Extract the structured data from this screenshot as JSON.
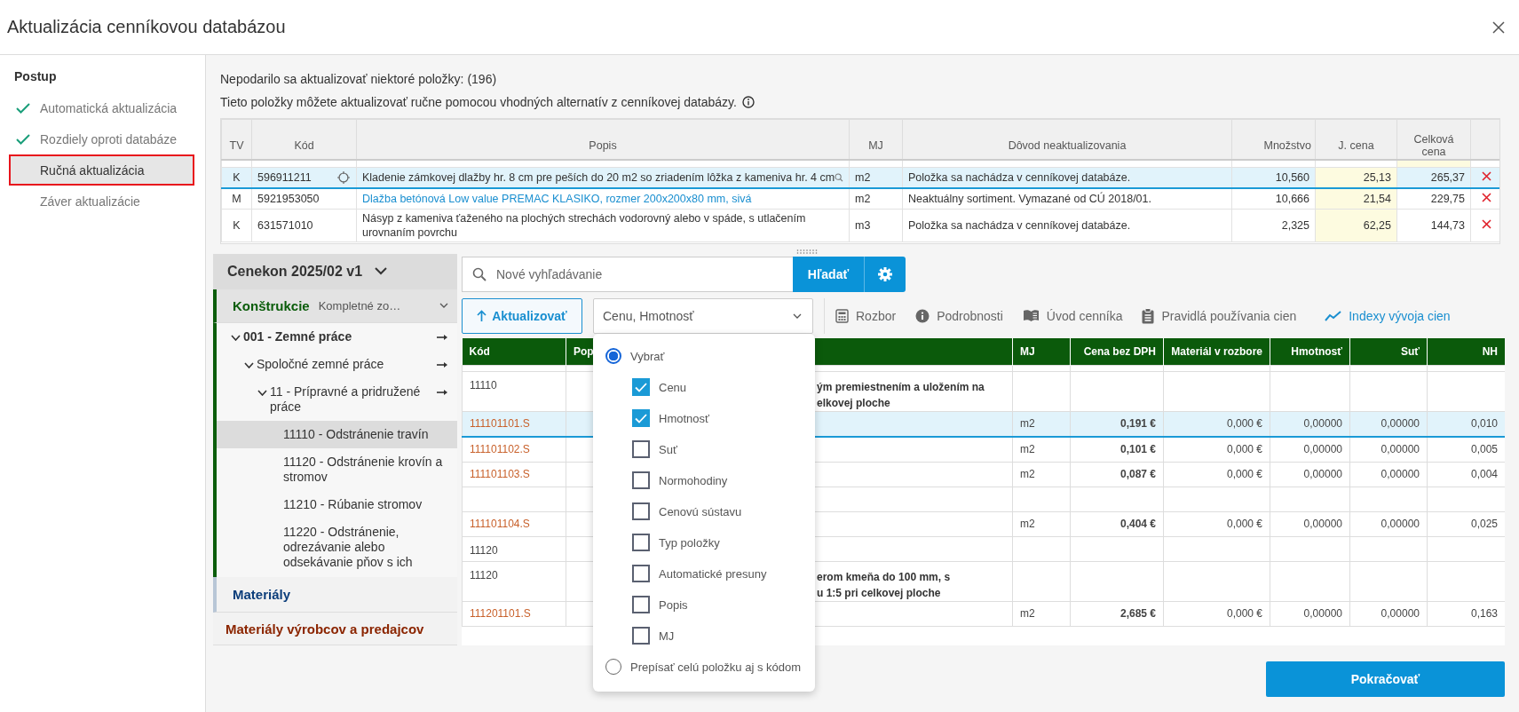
{
  "window": {
    "title": "Aktualizácia cenníkovou databázou"
  },
  "steps_title": "Postup",
  "steps": [
    {
      "label": "Automatická aktualizácia",
      "done": true,
      "selected": false
    },
    {
      "label": "Rozdiely oproti databáze",
      "done": true,
      "selected": false
    },
    {
      "label": "Ručná aktualizácia",
      "done": false,
      "selected": true
    },
    {
      "label": "Záver aktualizácie",
      "done": false,
      "selected": false
    }
  ],
  "notice": {
    "title": "Nepodarilo sa aktualizovať niektoré položky: (196)",
    "text": "Tieto položky môžete aktualizovať ručne pomocou vhodných alternatív z cenníkovej databázy."
  },
  "failed_table": {
    "columns": [
      "TV",
      "Kód",
      "Popis",
      "MJ",
      "Dôvod neaktualizovania",
      "Množstvo",
      "J. cena",
      "Celková cena"
    ],
    "rows": [
      {
        "tv": "K",
        "code": "596911211",
        "description": "Kladenie zámkovej dlažby hr. 8 cm pre peších do 20 m2 so zriadením lôžka z kameniva hr. 4 cm",
        "kind": "plain",
        "selected": true,
        "unit": "m2",
        "reason": "Položka sa nachádza v cenníkovej databáze.",
        "quantity": "10,560",
        "unit_price": "25,13",
        "total": "265,37"
      },
      {
        "tv": "M",
        "code": "5921953050",
        "description": "Dlažba betónová Low value PREMAC KLASIKO, rozmer 200x200x80 mm, sivá",
        "kind": "link",
        "selected": false,
        "unit": "m2",
        "reason": "Neaktuálny sortiment. Vymazané od CÚ 2018/01.",
        "quantity": "10,666",
        "unit_price": "21,54",
        "total": "229,75"
      },
      {
        "tv": "K",
        "code": "631571010",
        "description": "Násyp z kameniva ťaženého na plochých strechách vodorovný alebo v spáde, s utlačením urovnaním povrchu",
        "kind": "plain",
        "selected": false,
        "unit": "m3",
        "reason": "Položka sa nachádza v cenníkovej databáze.",
        "quantity": "2,325",
        "unit_price": "62,25",
        "total": "144,73"
      }
    ]
  },
  "catalog": {
    "title": "Cenekon 2025/02 v1",
    "sections": [
      {
        "label": "Konštrukcie",
        "color": "#0b5d0b",
        "filter": "Kompletné zo…",
        "children": [
          {
            "label": "001 - Zemné práce",
            "expanded": true,
            "children": [
              {
                "label": "Spoločné zemné práce",
                "expanded": true,
                "children": [
                  {
                    "label": "11 - Prípravné a pridružené práce",
                    "expanded": true,
                    "children": [
                      {
                        "label": "11110 - Odstránenie travín",
                        "selected": true
                      },
                      {
                        "label": "11120 - Odstránenie krovín a stromov",
                        "selected": false
                      },
                      {
                        "label": "11210 - Rúbanie stromov",
                        "selected": false
                      },
                      {
                        "label": "11220 - Odstránenie, odrezávanie alebo odsekávanie pňov s ich",
                        "selected": false
                      }
                    ]
                  }
                ]
              }
            ]
          }
        ]
      },
      {
        "label": "Materiály",
        "color": "#0b3d7a"
      },
      {
        "label": "Materiály výrobcov a predajcov",
        "color": "#8b2500"
      }
    ]
  },
  "search": {
    "placeholder": "Nové vyhľadávanie",
    "button": "Hľadať"
  },
  "toolbar": {
    "update_button": "Aktualizovať",
    "dropdown_value": "Cenu, Hmotnosť",
    "tools": [
      {
        "label": "Rozbor",
        "kind": "tool"
      },
      {
        "label": "Podrobnosti",
        "kind": "tool"
      },
      {
        "label": "Úvod cenníka",
        "kind": "tool"
      },
      {
        "label": "Pravidlá používania cien",
        "kind": "tool"
      },
      {
        "label": "Indexy vývoja cien",
        "kind": "link"
      }
    ]
  },
  "dropdown_menu": [
    {
      "kind": "radio",
      "label": "Vybrať",
      "selected": true
    },
    {
      "kind": "checkbox",
      "label": "Cenu",
      "checked": true
    },
    {
      "kind": "checkbox",
      "label": "Hmotnosť",
      "checked": true
    },
    {
      "kind": "checkbox",
      "label": "Suť",
      "checked": false
    },
    {
      "kind": "checkbox",
      "label": "Normohodiny",
      "checked": false
    },
    {
      "kind": "checkbox",
      "label": "Cenovú sústavu",
      "checked": false
    },
    {
      "kind": "checkbox",
      "label": "Typ položky",
      "checked": false
    },
    {
      "kind": "checkbox",
      "label": "Automatické presuny",
      "checked": false
    },
    {
      "kind": "checkbox",
      "label": "Popis",
      "checked": false
    },
    {
      "kind": "checkbox",
      "label": "MJ",
      "checked": false
    },
    {
      "kind": "radio",
      "label": "Prepísať celú položku aj s kódom",
      "selected": false
    }
  ],
  "price_table": {
    "columns": [
      "Kód",
      "Pop",
      "MJ",
      "Cena bez DPH",
      "Materiál v rozbore",
      "Hmotnosť",
      "Suť",
      "NH"
    ],
    "rows": [
      {
        "kind": "group",
        "code": "11110",
        "description": "ým premiestnením a uložením na\nelkovej ploche"
      },
      {
        "kind": "item",
        "selected": true,
        "code": "111101101.S",
        "unit": "m2",
        "price": "0,191 €",
        "material": "0,000 €",
        "weight": "0,00000",
        "debris": "0,00000",
        "hours": "0,010"
      },
      {
        "kind": "item",
        "selected": false,
        "code": "111101102.S",
        "unit": "m2",
        "price": "0,101 €",
        "material": "0,000 €",
        "weight": "0,00000",
        "debris": "0,00000",
        "hours": "0,005"
      },
      {
        "kind": "item",
        "selected": false,
        "code": "111101103.S",
        "unit": "m2",
        "price": "0,087 €",
        "material": "0,000 €",
        "weight": "0,00000",
        "debris": "0,00000",
        "hours": "0,004"
      },
      {
        "kind": "blank"
      },
      {
        "kind": "item",
        "selected": false,
        "code": "111101104.S",
        "unit": "m2",
        "price": "0,404 €",
        "material": "0,000 €",
        "weight": "0,00000",
        "debris": "0,00000",
        "hours": "0,025"
      },
      {
        "kind": "group",
        "code": "11120"
      },
      {
        "kind": "group",
        "code": "11120",
        "description": "erom kmeňa do 100 mm, s\nu 1:5 pri celkovej ploche"
      },
      {
        "kind": "item",
        "selected": false,
        "code": "111201101.S",
        "unit": "m2",
        "price": "2,685 €",
        "material": "0,000 €",
        "weight": "0,00000",
        "debris": "0,00000",
        "hours": "0,163"
      }
    ]
  },
  "footer": {
    "continue_button": "Pokračovať"
  }
}
